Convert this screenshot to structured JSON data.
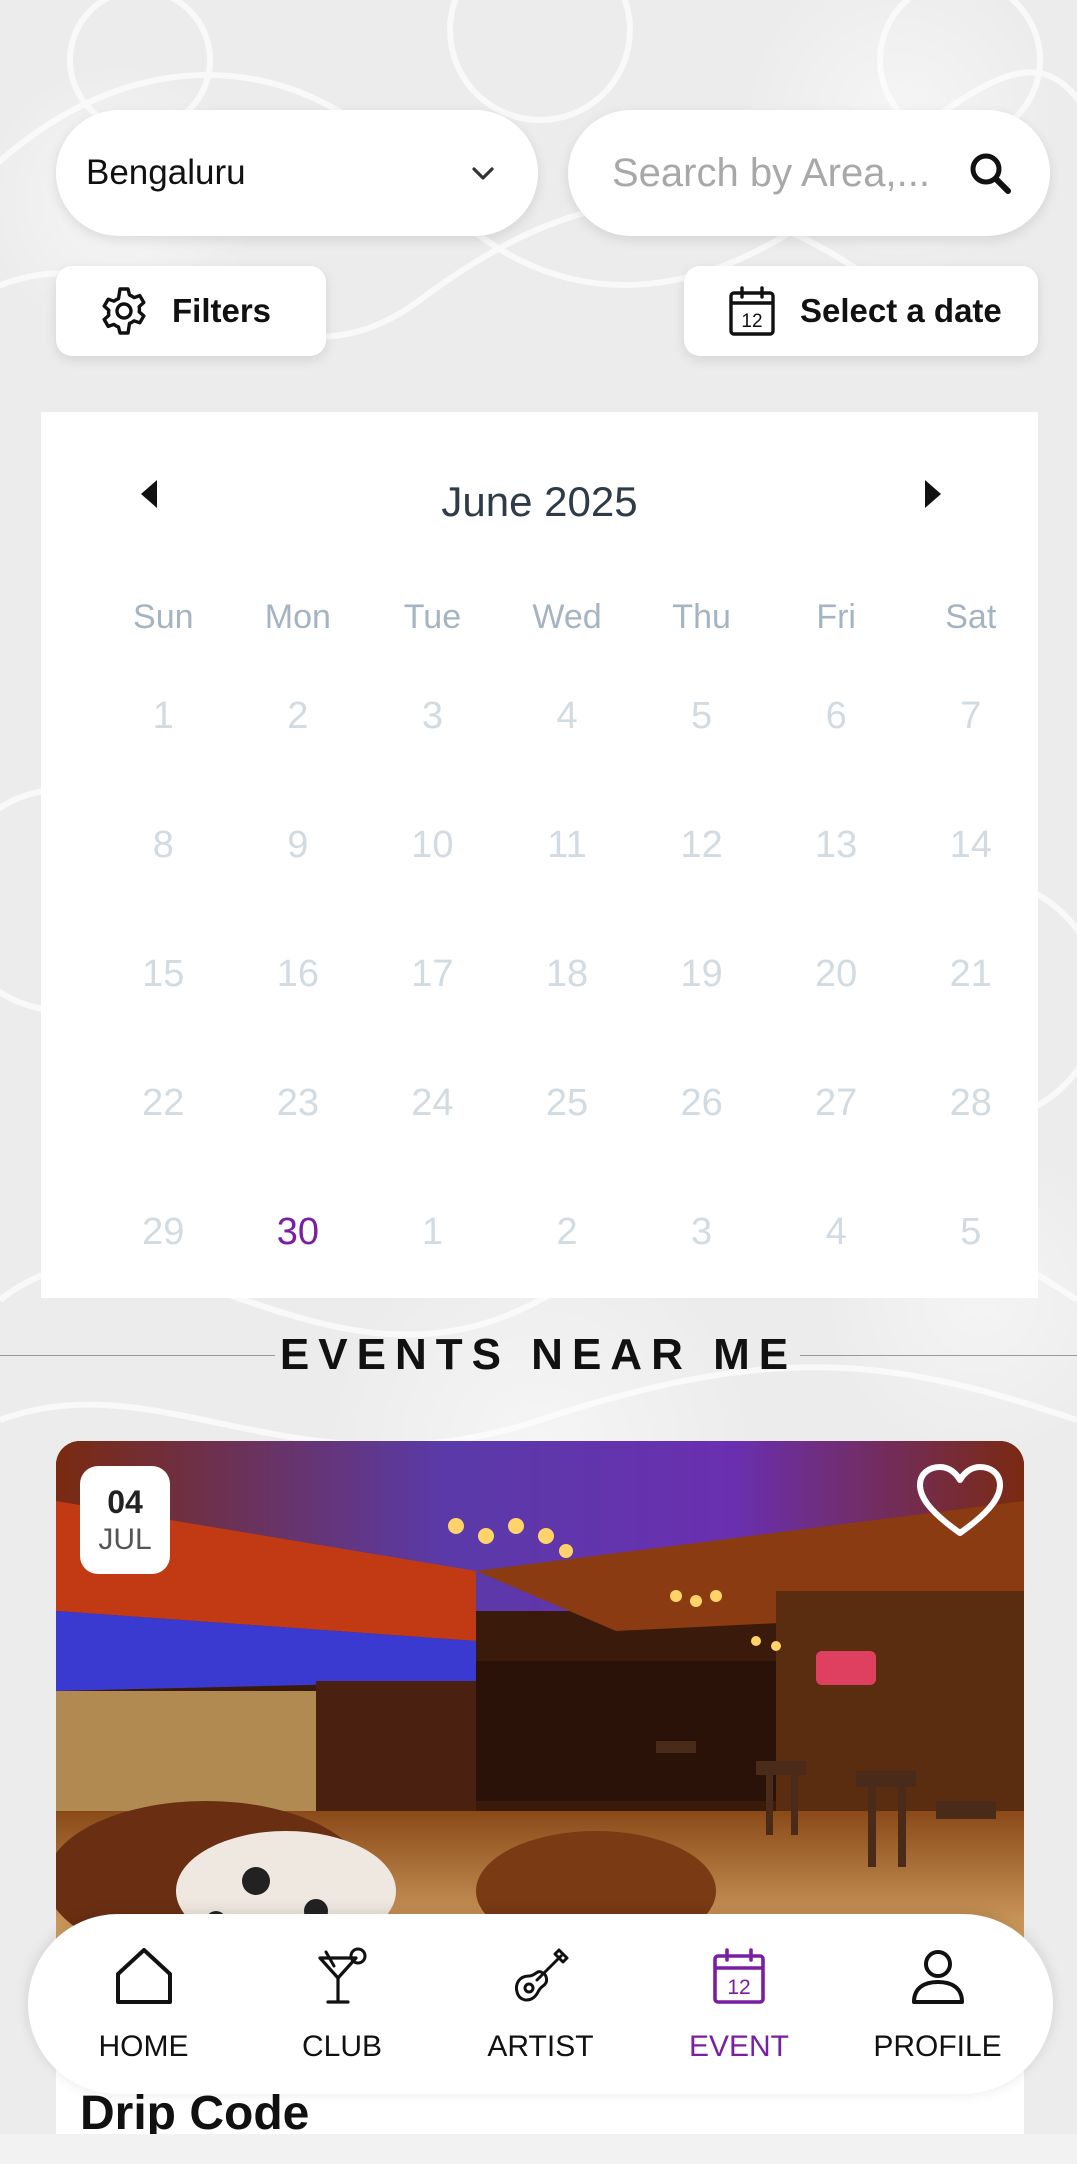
{
  "location": {
    "city": "Bengaluru"
  },
  "search": {
    "placeholder": "Search by Area,..."
  },
  "toolbar": {
    "filters_label": "Filters",
    "date_label": "Select a date",
    "date_icon_number": "12"
  },
  "calendar": {
    "month_label": "June 2025",
    "weekdays": [
      "Sun",
      "Mon",
      "Tue",
      "Wed",
      "Thu",
      "Fri",
      "Sat"
    ],
    "weeks": [
      [
        "1",
        "2",
        "3",
        "4",
        "5",
        "6",
        "7"
      ],
      [
        "8",
        "9",
        "10",
        "11",
        "12",
        "13",
        "14"
      ],
      [
        "15",
        "16",
        "17",
        "18",
        "19",
        "20",
        "21"
      ],
      [
        "22",
        "23",
        "24",
        "25",
        "26",
        "27",
        "28"
      ],
      [
        "29",
        "30",
        "1",
        "2",
        "3",
        "4",
        "5"
      ]
    ],
    "today": "30"
  },
  "section": {
    "title": "EVENTS NEAR ME"
  },
  "event": {
    "day": "04",
    "month": "JUL",
    "name": "Drip Code"
  },
  "nav": {
    "items": [
      {
        "label": "HOME",
        "icon": "home-icon"
      },
      {
        "label": "CLUB",
        "icon": "cocktail-icon"
      },
      {
        "label": "ARTIST",
        "icon": "guitar-icon"
      },
      {
        "label": "EVENT",
        "icon": "calendar-icon",
        "icon_number": "12"
      },
      {
        "label": "PROFILE",
        "icon": "user-icon"
      }
    ],
    "active_index": 3
  },
  "colors": {
    "accent": "#7a1fa2",
    "calendar_muted": "#d2dbe1",
    "weekday": "#a5b4c2"
  }
}
